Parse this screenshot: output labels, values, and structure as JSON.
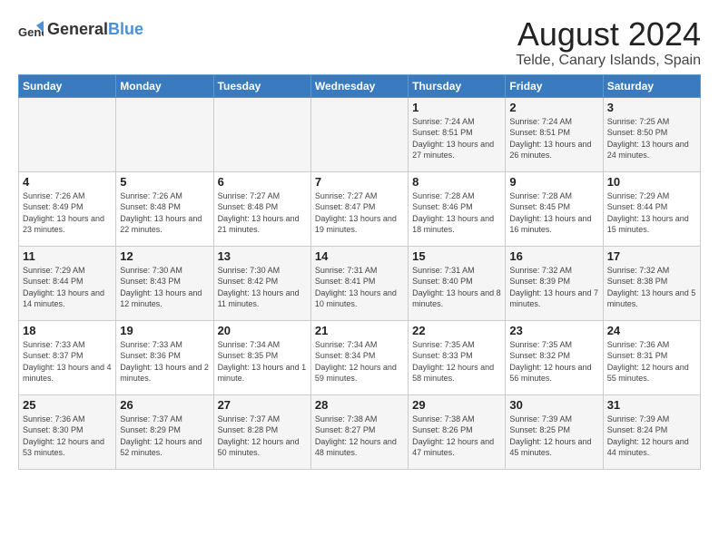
{
  "logo": {
    "general": "General",
    "blue": "Blue"
  },
  "title": "August 2024",
  "subtitle": "Telde, Canary Islands, Spain",
  "days_of_week": [
    "Sunday",
    "Monday",
    "Tuesday",
    "Wednesday",
    "Thursday",
    "Friday",
    "Saturday"
  ],
  "weeks": [
    [
      {
        "day": "",
        "info": ""
      },
      {
        "day": "",
        "info": ""
      },
      {
        "day": "",
        "info": ""
      },
      {
        "day": "",
        "info": ""
      },
      {
        "day": "1",
        "info": "Sunrise: 7:24 AM\nSunset: 8:51 PM\nDaylight: 13 hours and 27 minutes."
      },
      {
        "day": "2",
        "info": "Sunrise: 7:24 AM\nSunset: 8:51 PM\nDaylight: 13 hours and 26 minutes."
      },
      {
        "day": "3",
        "info": "Sunrise: 7:25 AM\nSunset: 8:50 PM\nDaylight: 13 hours and 24 minutes."
      }
    ],
    [
      {
        "day": "4",
        "info": "Sunrise: 7:26 AM\nSunset: 8:49 PM\nDaylight: 13 hours and 23 minutes."
      },
      {
        "day": "5",
        "info": "Sunrise: 7:26 AM\nSunset: 8:48 PM\nDaylight: 13 hours and 22 minutes."
      },
      {
        "day": "6",
        "info": "Sunrise: 7:27 AM\nSunset: 8:48 PM\nDaylight: 13 hours and 21 minutes."
      },
      {
        "day": "7",
        "info": "Sunrise: 7:27 AM\nSunset: 8:47 PM\nDaylight: 13 hours and 19 minutes."
      },
      {
        "day": "8",
        "info": "Sunrise: 7:28 AM\nSunset: 8:46 PM\nDaylight: 13 hours and 18 minutes."
      },
      {
        "day": "9",
        "info": "Sunrise: 7:28 AM\nSunset: 8:45 PM\nDaylight: 13 hours and 16 minutes."
      },
      {
        "day": "10",
        "info": "Sunrise: 7:29 AM\nSunset: 8:44 PM\nDaylight: 13 hours and 15 minutes."
      }
    ],
    [
      {
        "day": "11",
        "info": "Sunrise: 7:29 AM\nSunset: 8:44 PM\nDaylight: 13 hours and 14 minutes."
      },
      {
        "day": "12",
        "info": "Sunrise: 7:30 AM\nSunset: 8:43 PM\nDaylight: 13 hours and 12 minutes."
      },
      {
        "day": "13",
        "info": "Sunrise: 7:30 AM\nSunset: 8:42 PM\nDaylight: 13 hours and 11 minutes."
      },
      {
        "day": "14",
        "info": "Sunrise: 7:31 AM\nSunset: 8:41 PM\nDaylight: 13 hours and 10 minutes."
      },
      {
        "day": "15",
        "info": "Sunrise: 7:31 AM\nSunset: 8:40 PM\nDaylight: 13 hours and 8 minutes."
      },
      {
        "day": "16",
        "info": "Sunrise: 7:32 AM\nSunset: 8:39 PM\nDaylight: 13 hours and 7 minutes."
      },
      {
        "day": "17",
        "info": "Sunrise: 7:32 AM\nSunset: 8:38 PM\nDaylight: 13 hours and 5 minutes."
      }
    ],
    [
      {
        "day": "18",
        "info": "Sunrise: 7:33 AM\nSunset: 8:37 PM\nDaylight: 13 hours and 4 minutes."
      },
      {
        "day": "19",
        "info": "Sunrise: 7:33 AM\nSunset: 8:36 PM\nDaylight: 13 hours and 2 minutes."
      },
      {
        "day": "20",
        "info": "Sunrise: 7:34 AM\nSunset: 8:35 PM\nDaylight: 13 hours and 1 minute."
      },
      {
        "day": "21",
        "info": "Sunrise: 7:34 AM\nSunset: 8:34 PM\nDaylight: 12 hours and 59 minutes."
      },
      {
        "day": "22",
        "info": "Sunrise: 7:35 AM\nSunset: 8:33 PM\nDaylight: 12 hours and 58 minutes."
      },
      {
        "day": "23",
        "info": "Sunrise: 7:35 AM\nSunset: 8:32 PM\nDaylight: 12 hours and 56 minutes."
      },
      {
        "day": "24",
        "info": "Sunrise: 7:36 AM\nSunset: 8:31 PM\nDaylight: 12 hours and 55 minutes."
      }
    ],
    [
      {
        "day": "25",
        "info": "Sunrise: 7:36 AM\nSunset: 8:30 PM\nDaylight: 12 hours and 53 minutes."
      },
      {
        "day": "26",
        "info": "Sunrise: 7:37 AM\nSunset: 8:29 PM\nDaylight: 12 hours and 52 minutes."
      },
      {
        "day": "27",
        "info": "Sunrise: 7:37 AM\nSunset: 8:28 PM\nDaylight: 12 hours and 50 minutes."
      },
      {
        "day": "28",
        "info": "Sunrise: 7:38 AM\nSunset: 8:27 PM\nDaylight: 12 hours and 48 minutes."
      },
      {
        "day": "29",
        "info": "Sunrise: 7:38 AM\nSunset: 8:26 PM\nDaylight: 12 hours and 47 minutes."
      },
      {
        "day": "30",
        "info": "Sunrise: 7:39 AM\nSunset: 8:25 PM\nDaylight: 12 hours and 45 minutes."
      },
      {
        "day": "31",
        "info": "Sunrise: 7:39 AM\nSunset: 8:24 PM\nDaylight: 12 hours and 44 minutes."
      }
    ]
  ]
}
